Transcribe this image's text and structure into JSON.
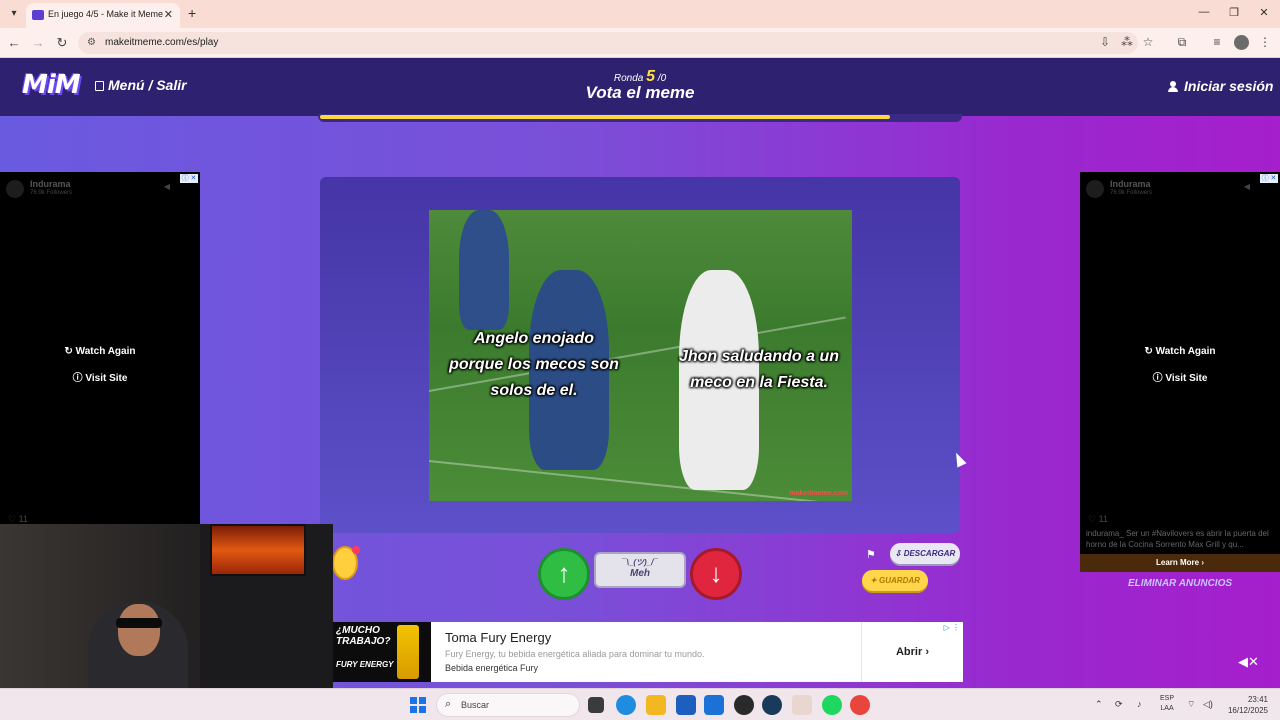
{
  "browser": {
    "tab_title": "En juego 4/5 - Make it Meme",
    "url": "makeitmeme.com/es/play"
  },
  "header": {
    "logo": "MiM",
    "menu_label": "Menú / Salir",
    "round_label": "Ronda",
    "round_current": "5",
    "round_total": "/0",
    "title": "Vota el meme",
    "login_label": "Iniciar sesión"
  },
  "progress": {
    "fraction": 0.89,
    "color": "#ffd83a"
  },
  "ads": {
    "side_brand": "Indurama",
    "side_followers": "76.9k Followers",
    "watch_again": "Watch Again",
    "visit_site": "Visit Site",
    "likes": "11",
    "caption": "indurama_ Ser un #Navilovers es abrir la puerta del horno de la Cocina Sorrento Max Grill y qu...",
    "learn_more": "Learn More",
    "remove_ads": "ELIMINAR ANUNCIOS"
  },
  "meme": {
    "left_caption_1": "Angelo enojado",
    "left_caption_2": "porque los mecos son",
    "left_caption_3": "solos de el.",
    "right_caption_1": "Jhon saludando a un",
    "right_caption_2": "meco en la Fiesta.",
    "watermark": "makeitmeme.com"
  },
  "controls": {
    "meh_face": "¯\\_(ツ)_/¯",
    "meh_label": "Meh",
    "download_label": "DESCARGAR",
    "save_label": "GUARDAR"
  },
  "bottom_ad": {
    "slogan": "¿MUCHO TRABAJO?",
    "brand": "FURY ENERGY",
    "title": "Toma Fury Energy",
    "description": "Fury Energy, tu bebida energética aliada para dominar tu mundo.",
    "subtitle": "Bebida energética Fury",
    "cta": "Abrir"
  },
  "taskbar": {
    "search_placeholder": "Buscar",
    "lang_1": "ESP",
    "lang_2": "LAA",
    "time": "23:41",
    "date": "16/12/2025"
  },
  "colors": {
    "header_bg": "#2d2170",
    "accent_yellow": "#ffd83a",
    "vote_up": "#2fbe43",
    "vote_down": "#e0263e"
  }
}
